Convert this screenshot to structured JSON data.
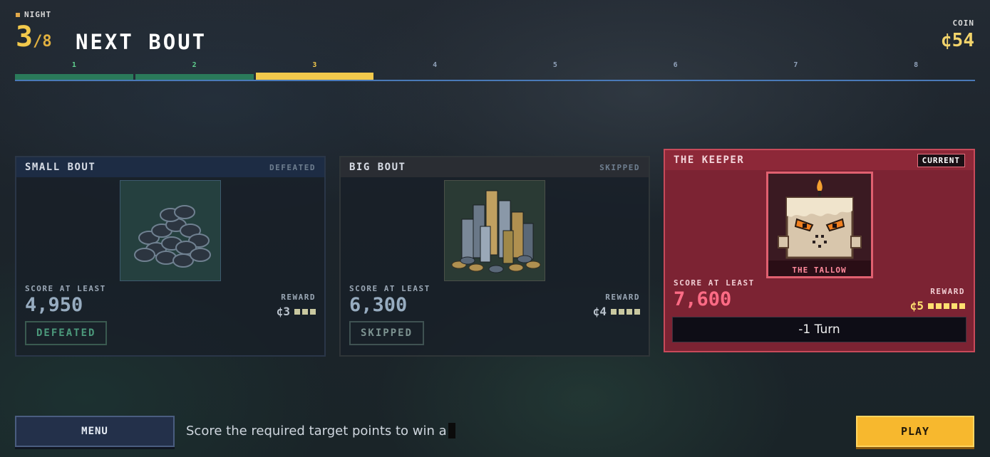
{
  "header": {
    "night_label": "NIGHT",
    "night_current": "3",
    "night_total": "/8",
    "title": "NEXT BOUT",
    "coin_label": "COIN",
    "coin_value": "¢54"
  },
  "progress": {
    "segments": [
      {
        "label": "1",
        "state": "done"
      },
      {
        "label": "2",
        "state": "done"
      },
      {
        "label": "3",
        "state": "active"
      },
      {
        "label": "4",
        "state": "todo"
      },
      {
        "label": "5",
        "state": "todo"
      },
      {
        "label": "6",
        "state": "todo"
      },
      {
        "label": "7",
        "state": "todo"
      },
      {
        "label": "8",
        "state": "todo"
      }
    ]
  },
  "bouts": {
    "small": {
      "title": "SMALL BOUT",
      "status": "DEFEATED",
      "art_icon": "poker-chip-pile-icon",
      "score_label": "SCORE AT LEAST",
      "score_value": "4,950",
      "reward_label": "REWARD",
      "reward_value": "¢3",
      "reward_pips": 3,
      "state_button": "DEFEATED"
    },
    "big": {
      "title": "BIG BOUT",
      "status": "SKIPPED",
      "art_icon": "poker-chip-stacks-icon",
      "score_label": "SCORE AT LEAST",
      "score_value": "6,300",
      "reward_label": "REWARD",
      "reward_value": "¢4",
      "reward_pips": 4,
      "state_button": "SKIPPED"
    },
    "keeper": {
      "title": "THE KEEPER",
      "badge": "CURRENT",
      "boss_name": "THE TALLOW",
      "art_icon": "candle-boss-icon",
      "score_label": "SCORE AT LEAST",
      "score_value": "7,600",
      "reward_label": "REWARD",
      "reward_value": "¢5",
      "reward_pips": 5,
      "effect": "-1 Turn"
    }
  },
  "footer": {
    "menu_label": "MENU",
    "hint": "Score the required target points to win a",
    "play_label": "PLAY"
  },
  "colors": {
    "accent_gold": "#f2c94c",
    "keeper_red": "#7c2333",
    "score_pink": "#ff6b85",
    "done_green": "#2a7a5a"
  }
}
